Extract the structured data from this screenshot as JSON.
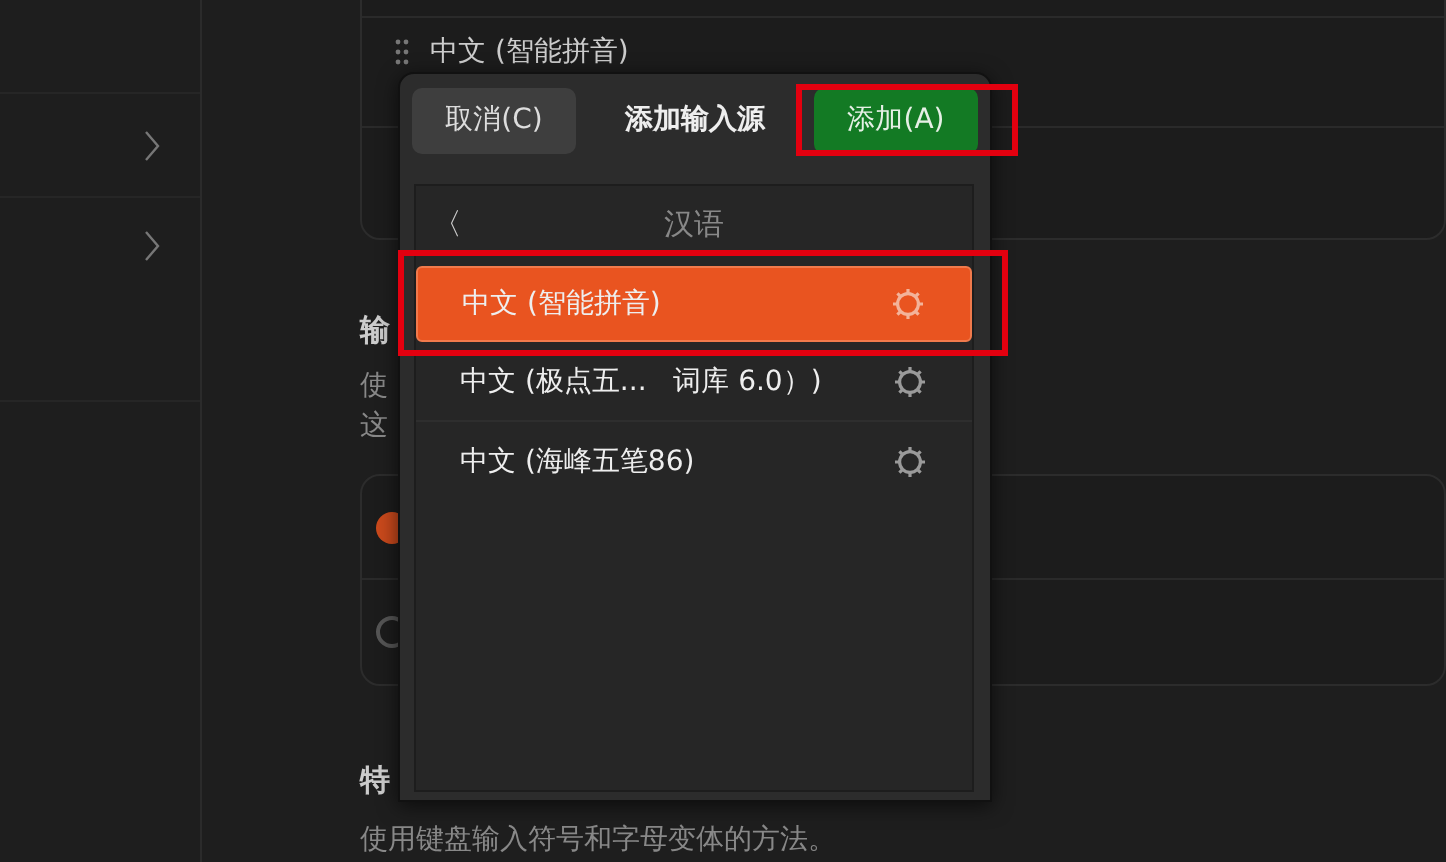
{
  "background": {
    "source_row": {
      "label": "中文 (智能拼音)"
    },
    "section_heading": "输",
    "section_desc": [
      "使",
      "这"
    ],
    "options": [
      {
        "selected": true
      },
      {
        "selected": false
      }
    ],
    "special_heading": "特",
    "special_desc": "使用键盘输入符号和字母变体的方法。"
  },
  "dialog": {
    "cancel_button": {
      "label": "取消(C)"
    },
    "title": "添加输入源",
    "add_button": {
      "label": "添加(A)",
      "highlighted": true
    },
    "language_header": {
      "back": "〈",
      "title": "汉语"
    },
    "sources": [
      {
        "label": "中文 (智能拼音)",
        "selected": true,
        "highlighted": true
      },
      {
        "label": "中文 (极点五...   词库 6.0）)",
        "selected": false,
        "highlighted": false
      },
      {
        "label": "中文 (海峰五笔86)",
        "selected": false,
        "highlighted": false
      }
    ]
  }
}
